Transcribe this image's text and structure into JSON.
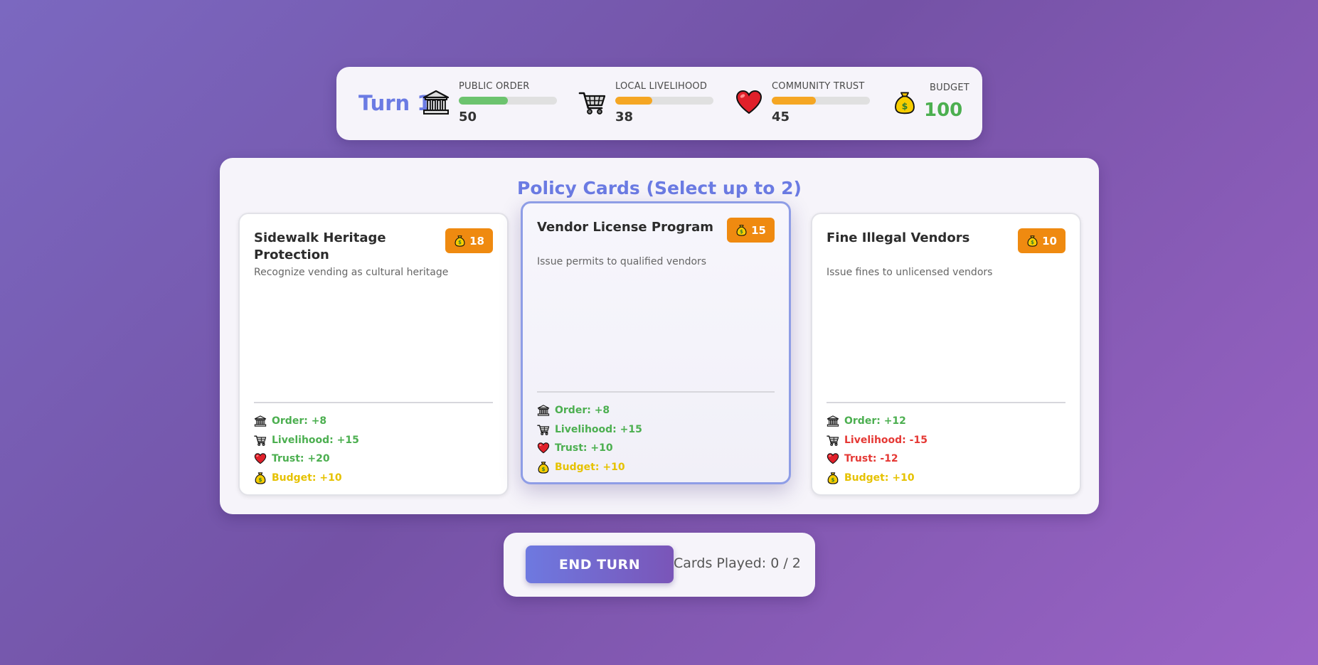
{
  "header": {
    "turn_label": "Turn 1",
    "stats": [
      {
        "name": "public-order",
        "label": "PUBLIC ORDER",
        "icon": "government-building-icon",
        "value": "50",
        "level": 0.5,
        "bar_color": "#6cc36e"
      },
      {
        "name": "local-livelihood",
        "label": "LOCAL LIVELIHOOD",
        "icon": "shopping-cart-icon",
        "value": "38",
        "level": 0.38,
        "bar_color": "#f5a623"
      },
      {
        "name": "community-trust",
        "label": "COMMUNITY TRUST",
        "icon": "heart-icon",
        "value": "45",
        "level": 0.45,
        "bar_color": "#f5a623"
      }
    ],
    "budget": {
      "label": "BUDGET",
      "icon": "money-bag-icon",
      "value": "100",
      "color": "#4caf50"
    }
  },
  "policy": {
    "title": "Policy Cards (Select up to 2)",
    "cards": [
      {
        "title": "Sidewalk Heritage Protection",
        "cost": "18",
        "description": "Recognize vending as cultural heritage",
        "selected": false,
        "effects": [
          {
            "icon": "government-building-icon",
            "text": "Order: +8",
            "tone": "pos"
          },
          {
            "icon": "shopping-cart-icon",
            "text": "Livelihood: +15",
            "tone": "pos"
          },
          {
            "icon": "heart-icon",
            "text": "Trust: +20",
            "tone": "pos"
          },
          {
            "icon": "money-bag-icon",
            "text": "Budget: +10",
            "tone": "gold"
          }
        ]
      },
      {
        "title": "Vendor License Program",
        "cost": "15",
        "description": "Issue permits to qualified vendors",
        "selected": true,
        "effects": [
          {
            "icon": "government-building-icon",
            "text": "Order: +8",
            "tone": "pos"
          },
          {
            "icon": "shopping-cart-icon",
            "text": "Livelihood: +15",
            "tone": "pos"
          },
          {
            "icon": "heart-icon",
            "text": "Trust: +10",
            "tone": "pos"
          },
          {
            "icon": "money-bag-icon",
            "text": "Budget: +10",
            "tone": "gold"
          }
        ]
      },
      {
        "title": "Fine Illegal Vendors",
        "cost": "10",
        "description": "Issue fines to unlicensed vendors",
        "selected": false,
        "effects": [
          {
            "icon": "government-building-icon",
            "text": "Order: +12",
            "tone": "pos"
          },
          {
            "icon": "shopping-cart-icon",
            "text": "Livelihood: -15",
            "tone": "neg"
          },
          {
            "icon": "heart-icon",
            "text": "Trust: -12",
            "tone": "neg"
          },
          {
            "icon": "money-bag-icon",
            "text": "Budget: +10",
            "tone": "gold"
          }
        ]
      }
    ]
  },
  "controls": {
    "end_turn_label": "END TURN",
    "cards_played": "Cards Played: 0 / 2"
  },
  "colors": {
    "accent": "#6b7be3",
    "cost_badge": "#ef8a10",
    "positive": "#4caf50",
    "negative": "#e53935",
    "budget_effect": "#e6c200"
  }
}
